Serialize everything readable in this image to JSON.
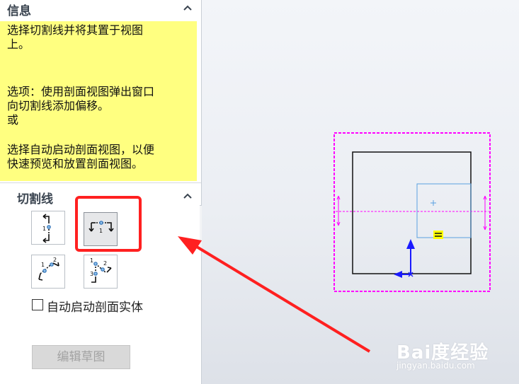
{
  "info": {
    "title": "信息",
    "lines": [
      "选择切割线并将其置于视图",
      "上。",
      "选项：使用剖面视图弹出窗口",
      "向切割线添加偏移。",
      "或",
      "选择自动启动剖面视图，以便",
      "快速预览和放置剖面视图。"
    ]
  },
  "cutting_line": {
    "title": "切割线",
    "buttons": [
      {
        "icon": "vertical-cutting-line-icon",
        "active": false
      },
      {
        "icon": "horizontal-cutting-line-icon",
        "active": true
      },
      {
        "icon": "auxiliary-cutting-line-icon",
        "active": false
      },
      {
        "icon": "aligned-cutting-line-icon",
        "active": false
      }
    ]
  },
  "auto_start": {
    "label": "自动启动剖面实体",
    "checked": false
  },
  "edit_sketch": {
    "label": "编辑草图",
    "enabled": false
  },
  "watermark": {
    "logo": "Bai度经验",
    "url": "jingyan.baidu.com"
  },
  "colors": {
    "info_bg": "#ffff80",
    "highlight": "#ff2020",
    "section_line": "#ff00ff",
    "selection_box": "#5aa0e0",
    "axis": "#1a1aff"
  }
}
